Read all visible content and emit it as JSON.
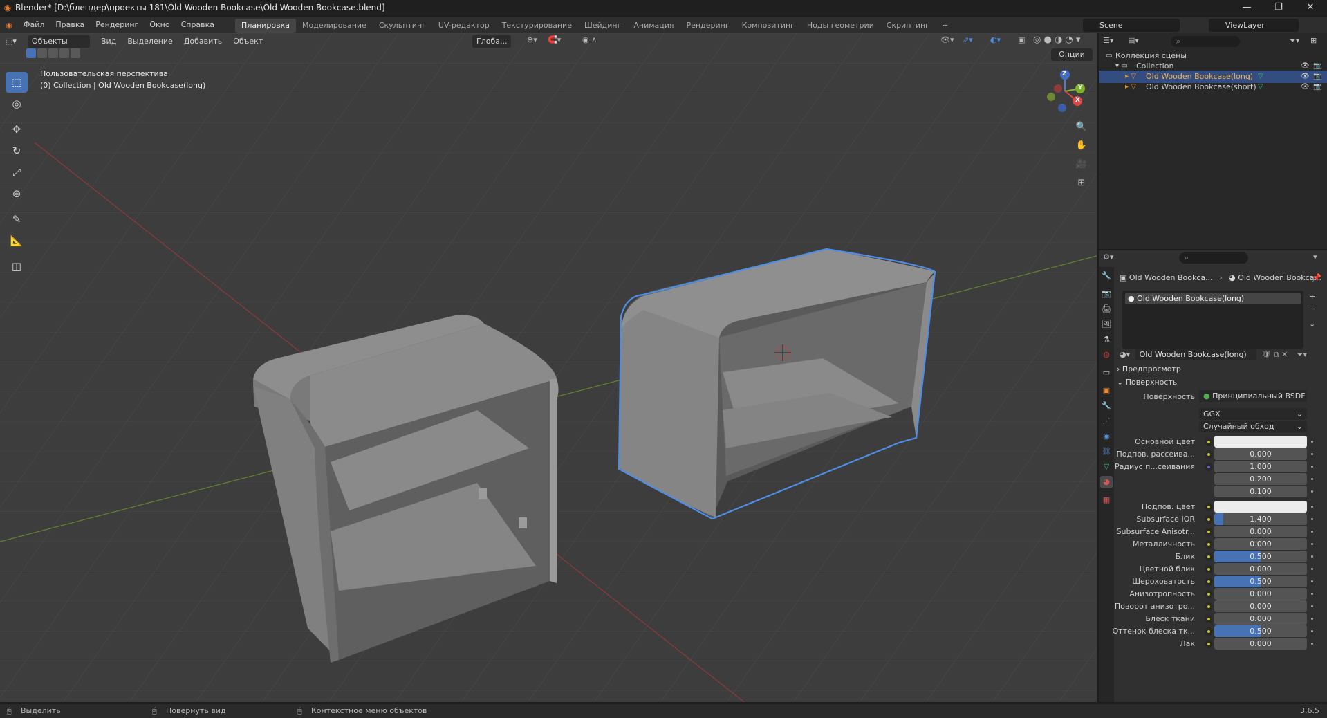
{
  "window": {
    "title": "Blender* [D:\\блендер\\проекты 181\\Old Wooden Bookcase\\Old Wooden Bookcase.blend]",
    "minimize": "—",
    "maximize": "❐",
    "close": "✕"
  },
  "menu": [
    "Файл",
    "Правка",
    "Рендеринг",
    "Окно",
    "Справка"
  ],
  "workspaces": [
    {
      "label": "Планировка",
      "active": true
    },
    {
      "label": "Моделирование",
      "active": false
    },
    {
      "label": "Скульптинг",
      "active": false
    },
    {
      "label": "UV-редактор",
      "active": false
    },
    {
      "label": "Текстурирование",
      "active": false
    },
    {
      "label": "Шейдинг",
      "active": false
    },
    {
      "label": "Анимация",
      "active": false
    },
    {
      "label": "Рендеринг",
      "active": false
    },
    {
      "label": "Композитинг",
      "active": false
    },
    {
      "label": "Ноды геометрии",
      "active": false
    },
    {
      "label": "Скриптинг",
      "active": false
    }
  ],
  "add_workspace": "+",
  "scene": {
    "name": "Scene",
    "view_layer": "ViewLayer"
  },
  "viewport": {
    "mode": "Объекты",
    "header_menus": [
      "Вид",
      "Выделение",
      "Добавить",
      "Объект"
    ],
    "transform_orientation": "Глоба...",
    "options": "Опции",
    "perspective_label": "Пользовательская перспектива",
    "collection_label": "(0) Collection | Old Wooden Bookcase(long)",
    "gizmo": {
      "x": "X",
      "y": "Y",
      "z": "Z"
    }
  },
  "outliner": {
    "search_placeholder": "",
    "rows": [
      {
        "label": "Коллекция сцены",
        "depth": 0,
        "selected": false
      },
      {
        "label": "Collection",
        "depth": 1,
        "selected": false
      },
      {
        "label": "Old Wooden Bookcase(long)",
        "depth": 2,
        "selected": true
      },
      {
        "label": "Old Wooden Bookcase(short)",
        "depth": 2,
        "selected": false
      }
    ]
  },
  "properties": {
    "breadcrumb_object": "Old Wooden Bookca...",
    "breadcrumb_material": "Old Wooden Bookca...",
    "material_slot": "Old Wooden Bookcase(long)",
    "material_name": "Old Wooden Bookcase(long)",
    "panels": {
      "preview": "Предпросмотр",
      "surface": "Поверхность"
    },
    "surface_label": "Поверхность",
    "surface_value": "Принципиальный BSDF",
    "distribution": "GGX",
    "subsurface_method": "Случайный обход",
    "fields": [
      {
        "label": "Основной цвет",
        "type": "color",
        "value": ""
      },
      {
        "label": "Подпов. рассеива...",
        "type": "number",
        "value": "0.000",
        "fill": 0
      },
      {
        "label": "Радиус п...сеивания",
        "type": "number",
        "value": "1.000",
        "fill": 0
      },
      {
        "label": "",
        "type": "number",
        "value": "0.200",
        "fill": 0
      },
      {
        "label": "",
        "type": "number",
        "value": "0.100",
        "fill": 0
      },
      {
        "label": "Подпов. цвет",
        "type": "color",
        "value": ""
      },
      {
        "label": "Subsurface IOR",
        "type": "number",
        "value": "1.400",
        "fill": 0.1
      },
      {
        "label": "Subsurface Anisotr...",
        "type": "number",
        "value": "0.000",
        "fill": 0
      },
      {
        "label": "Металличность",
        "type": "number",
        "value": "0.000",
        "fill": 0
      },
      {
        "label": "Блик",
        "type": "number",
        "value": "0.500",
        "fill": 0.5
      },
      {
        "label": "Цветной блик",
        "type": "number",
        "value": "0.000",
        "fill": 0
      },
      {
        "label": "Шероховатость",
        "type": "number",
        "value": "0.500",
        "fill": 0.5
      },
      {
        "label": "Анизотропность",
        "type": "number",
        "value": "0.000",
        "fill": 0
      },
      {
        "label": "Поворот анизотро...",
        "type": "number",
        "value": "0.000",
        "fill": 0
      },
      {
        "label": "Блеск ткани",
        "type": "number",
        "value": "0.000",
        "fill": 0
      },
      {
        "label": "Оттенок блеска тк...",
        "type": "number",
        "value": "0.500",
        "fill": 0.5
      },
      {
        "label": "Лак",
        "type": "number",
        "value": "0.000",
        "fill": 0
      }
    ]
  },
  "statusbar": {
    "select": "Выделить",
    "rotate": "Повернуть вид",
    "context": "Контекстное меню объектов",
    "version": "3.6.5"
  }
}
